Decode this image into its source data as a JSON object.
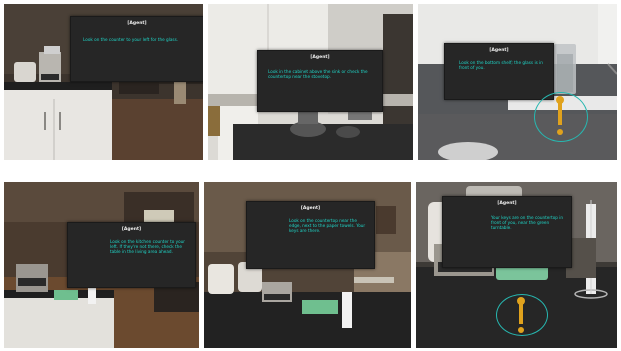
{
  "frames": [
    {
      "title": "[Agent]",
      "message": "Look on the counter to your left for the glass."
    },
    {
      "title": "[Agent]",
      "message": "Look in the cabinet above the sink or check the countertop near the stovetop."
    },
    {
      "title": "[Agent]",
      "message": "Look on the bottom shelf; the glass is in front of you."
    },
    {
      "title": "[Agent]",
      "message": "Look on the kitchen counter to your left. If they're not there, check the table in the living area ahead."
    },
    {
      "title": "[Agent]",
      "message": "Look on the countertop near the edge, next to the paper towels. Your keys are there."
    },
    {
      "title": "[Agent]",
      "message": "Your keys are on the countertop in front of you, near the green turntable."
    }
  ],
  "colors": {
    "panel_bg": "#262626",
    "title_text": "#f2f2f2",
    "message_text": "#1fd6c8",
    "marker_ring": "#27b7b0",
    "marker_pin": "#e0a21d"
  }
}
